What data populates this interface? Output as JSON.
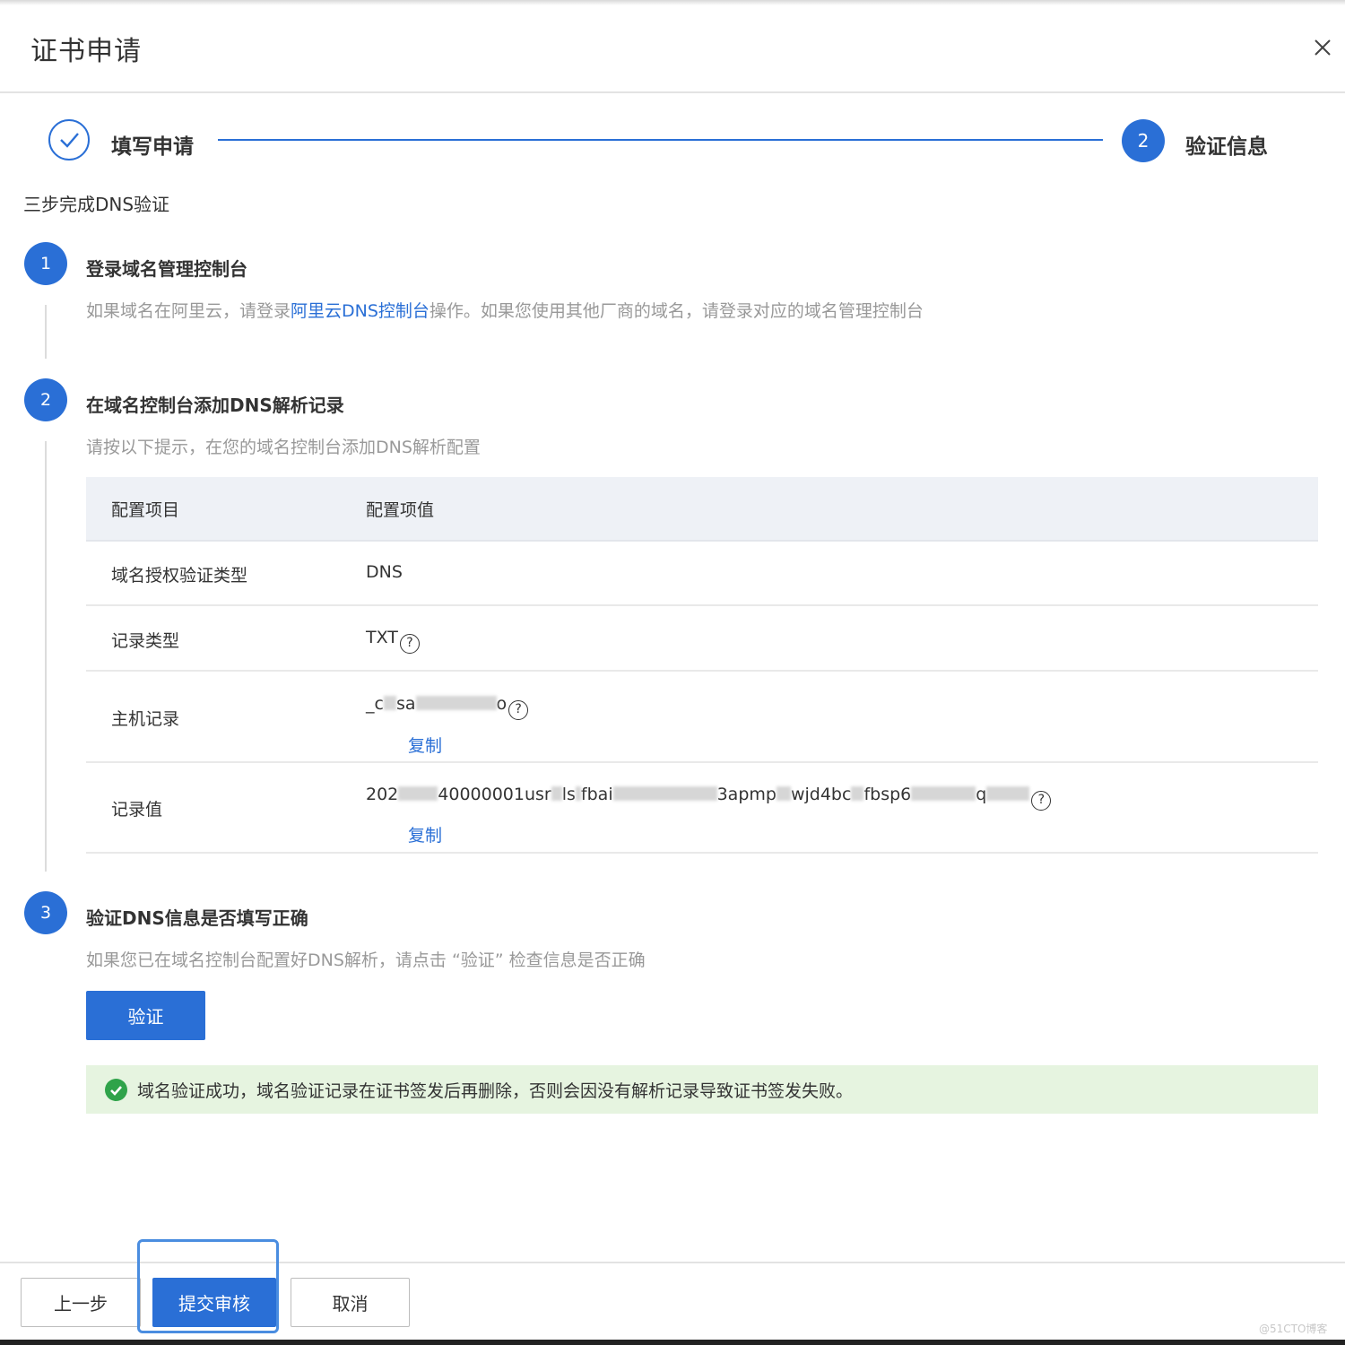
{
  "dialog": {
    "title": "证书申请",
    "close_icon": "close-icon"
  },
  "wizard": {
    "step1_label": "填写申请",
    "step1_icon": "check-icon",
    "step2_number": "2",
    "step2_label": "验证信息",
    "accent_color": "#2a6fd6"
  },
  "section_heading": "三步完成DNS验证",
  "steps": [
    {
      "number": "1",
      "title": "登录域名管理控制台",
      "desc_prefix": "如果域名在阿里云，请登录",
      "desc_link": "阿里云DNS控制台",
      "desc_suffix": "操作。如果您使用其他厂商的域名，请登录对应的域名管理控制台"
    },
    {
      "number": "2",
      "title": "在域名控制台添加DNS解析记录",
      "desc": "请按以下提示，在您的域名控制台添加DNS解析配置"
    },
    {
      "number": "3",
      "title": "验证DNS信息是否填写正确",
      "desc": "如果您已在域名控制台配置好DNS解析，请点击 “验证” 检查信息是否正确"
    }
  ],
  "table": {
    "headers": [
      "配置项目",
      "配置项值"
    ],
    "rows": [
      {
        "key": "域名授权验证类型",
        "value": "DNS"
      },
      {
        "key": "记录类型",
        "value": "TXT"
      },
      {
        "key": "主机记录",
        "value_parts": [
          "_c",
          "sa",
          "o"
        ],
        "copy": "复制"
      },
      {
        "key": "记录值",
        "value_parts": [
          "202",
          "40000001usr",
          "ls",
          "fbai",
          "3apmp",
          "wjd4bc",
          "fbsp6",
          "q"
        ],
        "copy": "复制"
      }
    ]
  },
  "verify_button": "验证",
  "success": {
    "icon": "check-circle-icon",
    "text": "域名验证成功，域名验证记录在证书签发后再删除，否则会因没有解析记录导致证书签发失败。",
    "bg_color": "#e6f4e0"
  },
  "footer": {
    "prev": "上一步",
    "submit": "提交审核",
    "cancel": "取消"
  },
  "watermark": "@51CTO博客"
}
